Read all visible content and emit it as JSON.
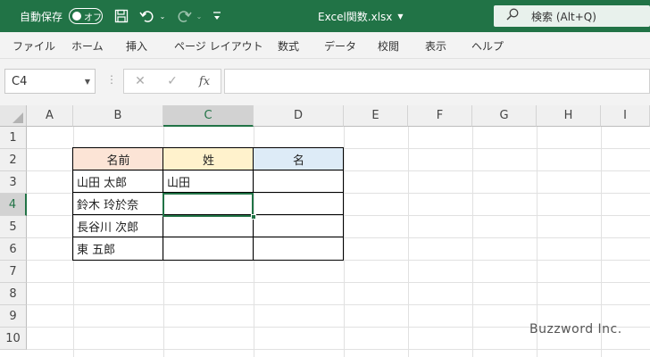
{
  "titlebar": {
    "autosave_label": "自動保存",
    "autosave_state": "オフ",
    "filename": "Excel関数.xlsx",
    "search_placeholder": "検索 (Alt+Q)",
    "icons": [
      "save-icon",
      "undo-icon",
      "redo-icon",
      "customize-icon"
    ]
  },
  "menu": [
    "ファイル",
    "ホーム",
    "挿入",
    "ページ レイアウト",
    "数式",
    "データ",
    "校閲",
    "表示",
    "ヘルプ"
  ],
  "formula_bar": {
    "name_box": "C4",
    "formula": "",
    "fx_label": "fx"
  },
  "sheet": {
    "columns": [
      "A",
      "B",
      "C",
      "D",
      "E",
      "F",
      "G",
      "H",
      "I"
    ],
    "rows": [
      "1",
      "2",
      "3",
      "4",
      "5",
      "6",
      "7",
      "8",
      "9",
      "10"
    ],
    "active_cell": "C4",
    "table": {
      "headers": [
        "名前",
        "姓",
        "名"
      ],
      "header_colors": [
        "#fce4d6",
        "#fff2cc",
        "#ddebf7"
      ],
      "rows": [
        [
          "山田 太郎",
          "山田",
          ""
        ],
        [
          "鈴木 玲於奈",
          "",
          ""
        ],
        [
          "長谷川 次郎",
          "",
          ""
        ],
        [
          "東 五郎",
          "",
          ""
        ]
      ]
    }
  },
  "watermark": "Buzzword Inc.",
  "colors": {
    "accent": "#217346"
  }
}
